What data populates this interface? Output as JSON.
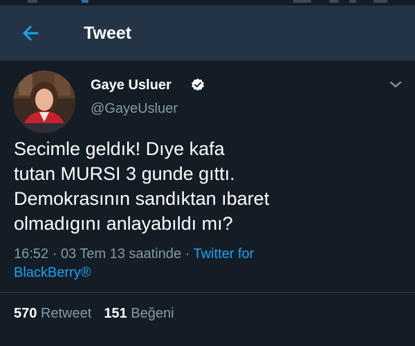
{
  "header": {
    "title": "Tweet",
    "back_icon": "arrow-left-icon"
  },
  "tweet": {
    "author_name": "Gaye Usluer",
    "author_handle": "@GayeUsluer",
    "verified_icon": "verified-badge-icon",
    "menu_icon": "chevron-down-icon",
    "text_lines": [
      "Secimle geldık! Dıye kafa",
      "tutan MURSI 3 gunde gıttı.",
      "Demokrasının sandıktan ıbaret",
      "olmadıgını anlayabıldı mı?"
    ],
    "time": "16:52",
    "sep1": " · ",
    "date": "03 Tem 13 saatinde",
    "sep2": " · ",
    "source_line1": "Twitter for",
    "source_line2": "BlackBerry®"
  },
  "stats": {
    "retweet_count": "570",
    "retweet_label": "Retweet",
    "like_count": "151",
    "like_label": "Beğeni"
  },
  "colors": {
    "background": "#141d26",
    "header": "#243447",
    "accent": "#1da1f2",
    "muted": "#8899a6"
  }
}
